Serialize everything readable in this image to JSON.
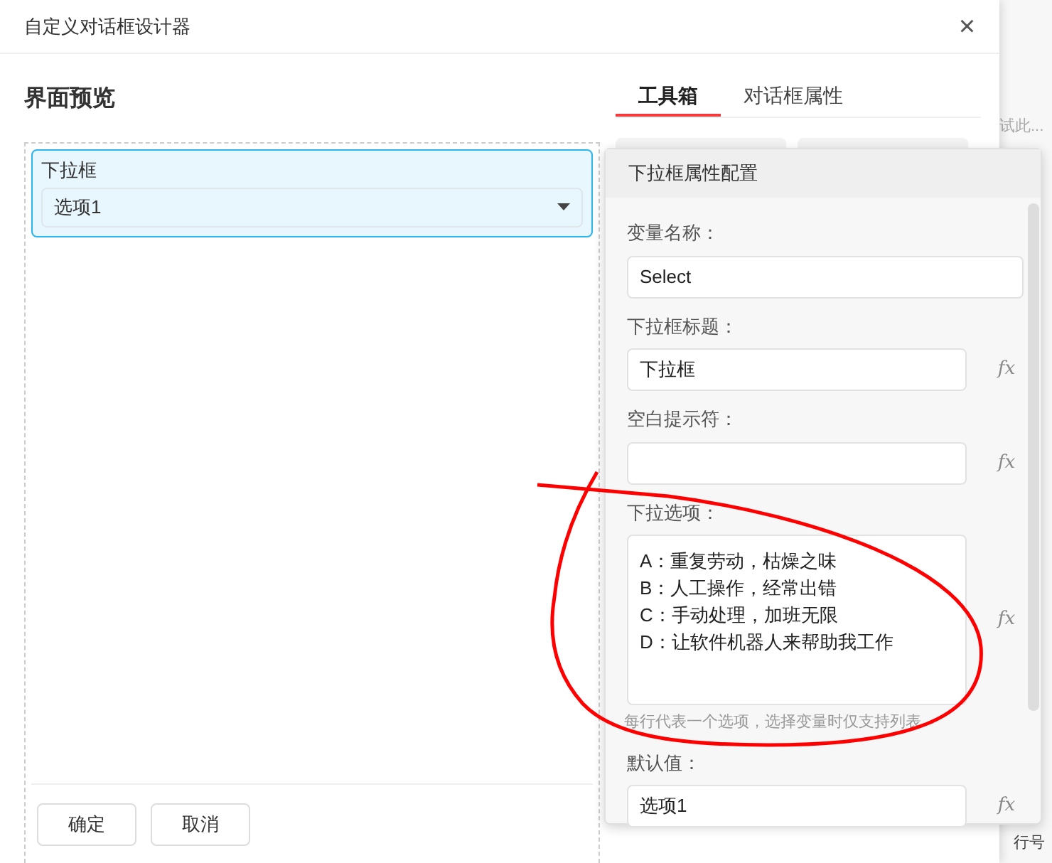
{
  "window": {
    "title": "自定义对话框设计器",
    "close": "×"
  },
  "preview": {
    "heading": "界面预览",
    "field": {
      "label": "下拉框",
      "value": "选项1",
      "selected": true
    },
    "buttons": [
      "确定",
      "取消"
    ]
  },
  "tabs": [
    {
      "label": "工具箱",
      "selected": true
    },
    {
      "label": "对话框属性",
      "selected": false
    }
  ],
  "popover": {
    "title": "下拉框属性配置",
    "fields": [
      {
        "label": "变量名称：",
        "value": "Select",
        "kind": "input"
      },
      {
        "label": "下拉框标题：",
        "value": "下拉框",
        "fx": "fx",
        "kind": "input"
      },
      {
        "label": "空白提示符：",
        "fx": "fx",
        "kind": "input"
      },
      {
        "label": "下拉选项：",
        "lines": [
          "A：重复劳动，枯燥之味",
          "B：人工操作，经常出错",
          "C：手动处理，加班无限",
          "D：让软件机器人来帮助我工作"
        ],
        "hint": "每行代表一个选项，选择变量时仅支持列表",
        "fx": "fx",
        "kind": "textarea"
      },
      {
        "label": "默认值：",
        "value": "选项1",
        "fx": "fx",
        "kind": "input"
      }
    ]
  },
  "background": [
    "试此...",
    "行号"
  ]
}
